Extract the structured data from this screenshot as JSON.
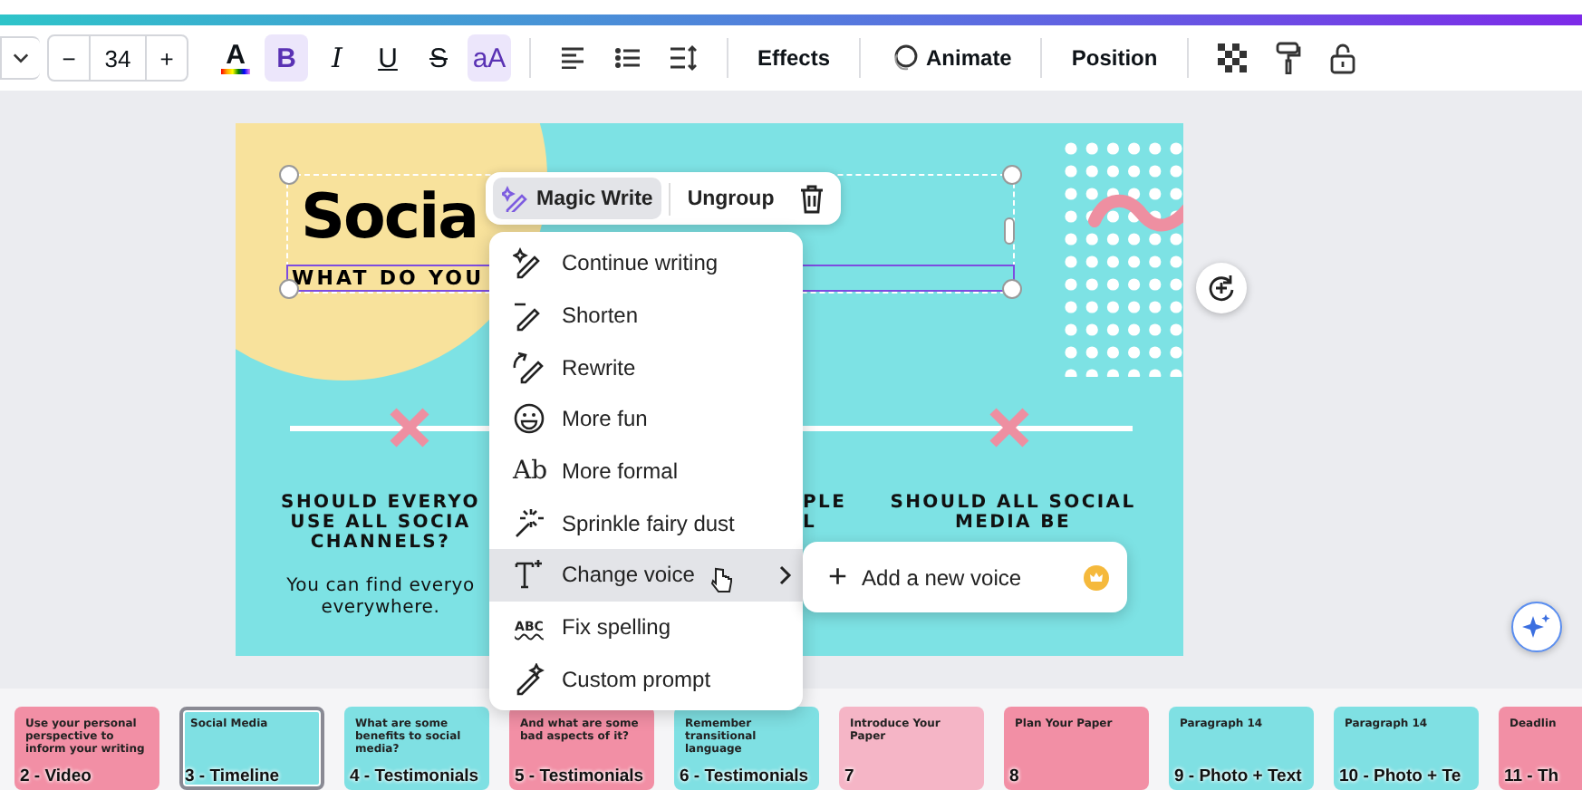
{
  "toolbar": {
    "decrement": "−",
    "font_size": "34",
    "increment": "+",
    "format_buttons": [
      {
        "glyph": "A",
        "kind": "color",
        "selected": false
      },
      {
        "glyph": "B",
        "kind": "bold",
        "selected": true
      },
      {
        "glyph": "I",
        "kind": "italic",
        "selected": false
      },
      {
        "glyph": "U",
        "kind": "underline",
        "selected": false
      },
      {
        "glyph": "S",
        "kind": "strike",
        "selected": false
      },
      {
        "glyph": "aA",
        "kind": "case",
        "selected": true
      }
    ],
    "effects": "Effects",
    "animate": "Animate",
    "position": "Position"
  },
  "slide": {
    "title": "Socia",
    "subtitle": "WHAT DO YOU",
    "column_1": {
      "heading_lines": [
        "SHOULD EVERYO",
        "USE ALL SOCIA",
        "CHANNELS?"
      ],
      "body_lines": [
        "You can find everyo",
        "everywhere."
      ]
    },
    "column_2": {
      "heading_lines": [
        "PLE",
        "L"
      ]
    },
    "column_3": {
      "heading_lines": [
        "SHOULD ALL SOCIAL",
        "MEDIA BE"
      ]
    }
  },
  "floating_toolbar": {
    "items": [
      {
        "label": "Magic Write",
        "selected": true
      },
      {
        "label": "Ungroup",
        "selected": false
      }
    ]
  },
  "magic_menu": {
    "items": [
      {
        "label": "Continue writing",
        "selected": false,
        "submenu": false
      },
      {
        "label": "Shorten",
        "selected": false,
        "submenu": false
      },
      {
        "label": "Rewrite",
        "selected": false,
        "submenu": false
      },
      {
        "label": "More fun",
        "selected": false,
        "submenu": false
      },
      {
        "label": "More formal",
        "glyph": "Ab",
        "selected": false,
        "submenu": false
      },
      {
        "label": "Sprinkle fairy dust",
        "selected": false,
        "submenu": false
      },
      {
        "label": "Change voice",
        "selected": true,
        "submenu": true
      },
      {
        "label": "Fix spelling",
        "glyph": "ABC",
        "selected": false,
        "submenu": false
      },
      {
        "label": "Custom prompt",
        "selected": false,
        "submenu": false
      }
    ]
  },
  "submenu": {
    "plus": "+",
    "label": "Add a new voice"
  },
  "pages": [
    {
      "label": "2 - Video",
      "title": "Use your personal perspective to inform your writing",
      "color": "#f28fa5",
      "selected": false
    },
    {
      "label": "3 - Timeline",
      "title": "Social Media",
      "color": "#7fe0e3",
      "selected": true
    },
    {
      "label": "4 - Testimonials",
      "title": "What are some benefits to social media?",
      "color": "#7fe0e3",
      "selected": false
    },
    {
      "label": "5 - Testimonials",
      "title": "And what are some bad aspects of it?",
      "color": "#f28fa5",
      "selected": false
    },
    {
      "label": "6 - Testimonials",
      "title": "Remember transitional language",
      "color": "#7fe0e3",
      "selected": false
    },
    {
      "label": "7",
      "title": "Introduce Your Paper",
      "color": "#f5b5c6",
      "selected": false
    },
    {
      "label": "8",
      "title": "Plan Your Paper",
      "color": "#f28fa5",
      "selected": false
    },
    {
      "label": "9 - Photo + Text",
      "title": "Paragraph 14",
      "color": "#7fe0e3",
      "selected": false
    },
    {
      "label": "10 - Photo + Te",
      "title": "Paragraph 14",
      "color": "#7fe0e3",
      "selected": false
    },
    {
      "label": "11 - Th",
      "title": "Deadlin",
      "color": "#f28fa5",
      "selected": false
    }
  ]
}
